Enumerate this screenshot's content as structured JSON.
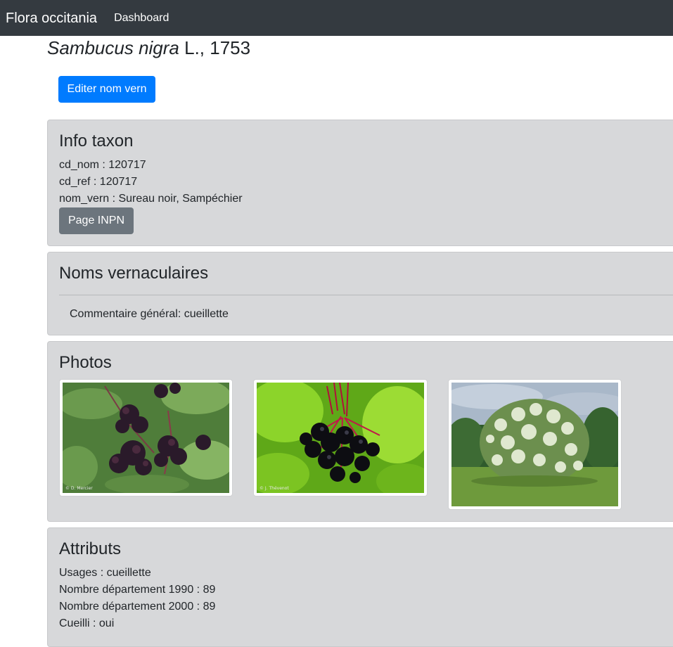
{
  "navbar": {
    "brand": "Flora occitania",
    "link": "Dashboard"
  },
  "taxon": {
    "scientific_name": "Sambucus nigra",
    "authority": "L., 1753"
  },
  "actions": {
    "edit_label": "Editer nom vern"
  },
  "info": {
    "heading": "Info taxon",
    "cd_nom": "cd_nom : 120717",
    "cd_ref": "cd_ref : 120717",
    "nom_vern": "nom_vern : Sureau noir, Sampéchier",
    "inpn_label": "Page INPN"
  },
  "vernaculars": {
    "heading": "Noms vernaculaires",
    "comment": "Commentaire général: cueillette"
  },
  "photos": {
    "heading": "Photos",
    "items": [
      {
        "subject": "elderberry clusters on branch",
        "credit": "© D. Mercier"
      },
      {
        "subject": "close-up of black elderberries",
        "credit": "© J. Thévenot"
      },
      {
        "subject": "flowering elder shrub in meadow",
        "credit": ""
      }
    ]
  },
  "attributes": {
    "heading": "Attributs",
    "usages": "Usages : cueillette",
    "dept_1990": "Nombre département 1990 : 89",
    "dept_2000": "Nombre département 2000 : 89",
    "cueilli": "Cueilli : oui"
  },
  "colors": {
    "navbar_bg": "#343a40",
    "primary": "#007bff",
    "secondary": "#6c757d",
    "card_bg": "#d7d8da"
  }
}
